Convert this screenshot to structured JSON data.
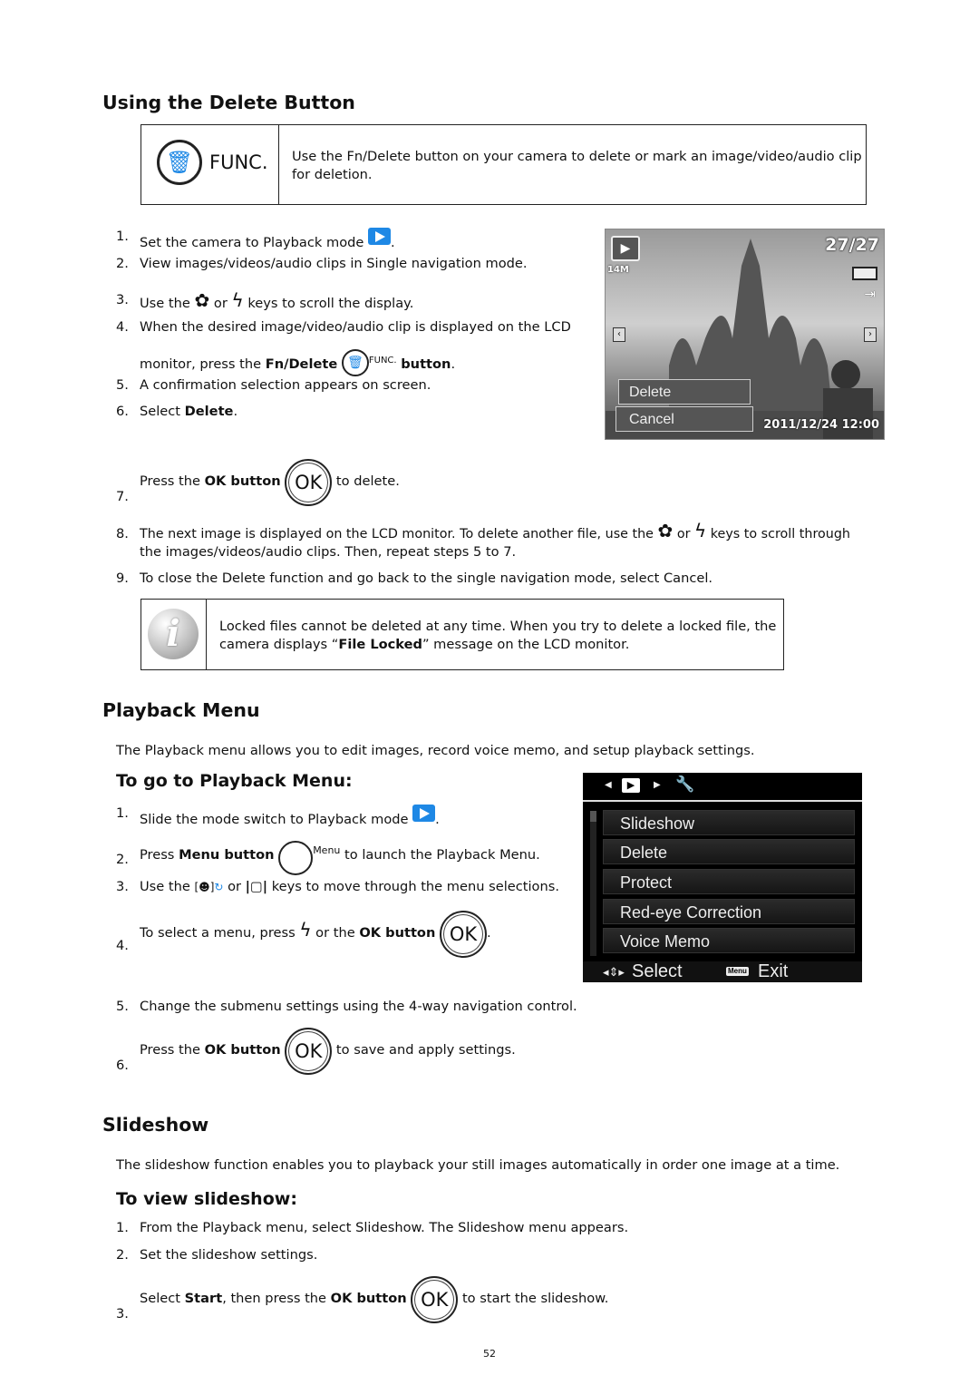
{
  "delete_section": {
    "title": "Using the Delete Button",
    "func_label": "FUNC.",
    "func_text_1": "Use the Fn/Delete button on your camera to delete or mark an image/video/audio clip",
    "func_text_2": "for deletion.",
    "steps": {
      "s1": {
        "n": "1.",
        "a": "Set the camera to Playback mode",
        "b": "."
      },
      "s2": {
        "n": "2.",
        "a": "View images/videos/audio clips in Single navigation mode."
      },
      "s3": {
        "n": "3.",
        "a": "Use the",
        "b": "or",
        "c": "keys to scroll the display."
      },
      "s4": {
        "n": "4.",
        "a": "When the desired image/video/audio clip is displayed on the LCD",
        "b": "monitor, press the",
        "c": "Fn/Delete",
        "d": "FUNC.",
        "e": "button",
        "f": "."
      },
      "s5": {
        "n": "5.",
        "a": "A confirmation selection appears on screen."
      },
      "s6": {
        "n": "6.",
        "a": "Select",
        "b": "Delete",
        "c": "."
      },
      "s7": {
        "n": "7.",
        "a": "Press the",
        "b": "OK button",
        "c": "to delete."
      },
      "s8": {
        "n": "8.",
        "a": "The next image is displayed on the LCD monitor. To delete another file, use the",
        "b": "or",
        "c": "keys to scroll through",
        "d": "the images/videos/audio clips. Then, repeat steps 5 to 7."
      },
      "s9": {
        "n": "9.",
        "a": "To close the Delete function and go back to the single navigation mode, select Cancel."
      }
    },
    "camera_screen": {
      "counter": "27/27",
      "resolution": "14M",
      "datetime": "2011/12/24 12:00",
      "options": [
        "Delete",
        "Cancel"
      ]
    },
    "note_1": "Locked files cannot be deleted at any time. When you try to delete a locked file, the",
    "note_2a": "camera displays “",
    "note_2b": "File Locked",
    "note_2c": "” message on the LCD monitor."
  },
  "playback_section": {
    "title": "Playback Menu",
    "intro": "The Playback menu allows you to edit images, record voice memo, and setup playback settings.",
    "subtitle": "To go to Playback Menu:",
    "steps": {
      "s1": {
        "n": "1.",
        "a": "Slide the mode switch to Playback mode",
        "b": "."
      },
      "s2": {
        "n": "2.",
        "a": "Press",
        "b": "Menu button",
        "c": "Menu",
        "d": "to launch the Playback Menu."
      },
      "s3": {
        "n": "3.",
        "a": "Use the",
        "b": "or",
        "c": "keys to move through the menu selections."
      },
      "s4": {
        "n": "4.",
        "a": "To select a menu, press",
        "b": "or the",
        "c": "OK button",
        "d": "."
      },
      "s5": {
        "n": "5.",
        "a": "Change the submenu settings using the 4-way navigation control."
      },
      "s6": {
        "n": "6.",
        "a": "Press the",
        "b": "OK button",
        "c": "to save and apply settings."
      }
    },
    "menu_screen": {
      "items": [
        "Slideshow",
        "Delete",
        "Protect",
        "Red-eye Correction",
        "Voice Memo"
      ],
      "select_label": "Select",
      "menu_key": "Menu",
      "exit_label": "Exit"
    }
  },
  "slideshow_section": {
    "title": "Slideshow",
    "intro": "The slideshow function enables you to playback your still images automatically in order one image at a time.",
    "subtitle": "To view slideshow:",
    "steps": {
      "s1": {
        "n": "1.",
        "a": "From the Playback menu, select Slideshow. The Slideshow menu appears."
      },
      "s2": {
        "n": "2.",
        "a": "Set the slideshow settings."
      },
      "s3": {
        "n": "3.",
        "a": "Select",
        "b": "Start",
        "c": ", then press the",
        "d": "OK button",
        "e": "to start the slideshow."
      }
    }
  },
  "ok_label": "OK",
  "page_number": "52",
  "accent_color": "#1e88e5"
}
